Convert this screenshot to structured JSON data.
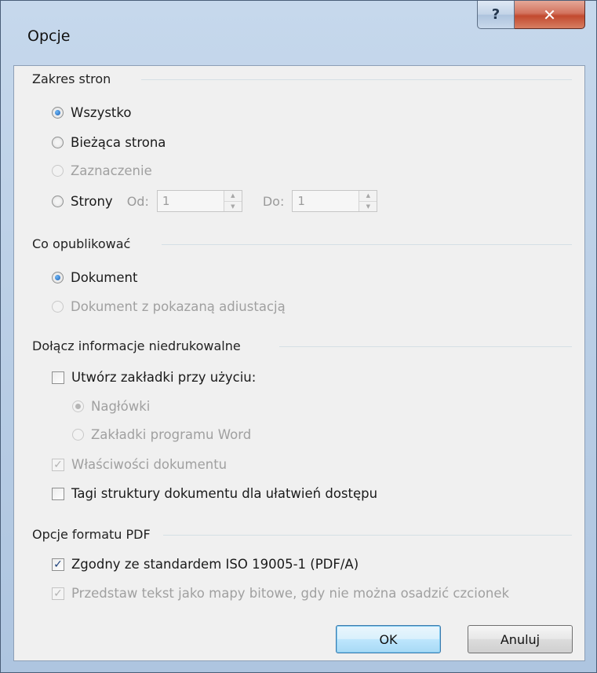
{
  "window": {
    "title": "Opcje",
    "help_glyph": "?",
    "close_glyph": "✕"
  },
  "page_range": {
    "heading": "Zakres stron",
    "all": "Wszystko",
    "current": "Bieżąca strona",
    "selection": "Zaznaczenie",
    "pages": "Strony",
    "from_label": "Od:",
    "from_value": "1",
    "to_label": "Do:",
    "to_value": "1",
    "selected": "all"
  },
  "publish": {
    "heading": "Co opublikować",
    "document": "Dokument",
    "document_markup": "Dokument z pokazaną adiustacją",
    "selected": "document"
  },
  "nonprint": {
    "heading": "Dołącz informacje niedrukowalne",
    "create_bookmarks": "Utwórz zakładki przy użyciu:",
    "create_bookmarks_checked": false,
    "headings": "Nagłówki",
    "word_bookmarks": "Zakładki programu Word",
    "doc_properties": "Właściwości dokumentu",
    "doc_properties_checked": true,
    "structure_tags": "Tagi struktury dokumentu dla ułatwień dostępu",
    "structure_tags_checked": false
  },
  "pdf": {
    "heading": "Opcje formatu PDF",
    "iso": "Zgodny ze standardem ISO 19005-1 (PDF/A)",
    "iso_checked": true,
    "bitmap": "Przedstaw tekst jako mapy bitowe, gdy nie można osadzić czcionek",
    "bitmap_checked": true
  },
  "buttons": {
    "ok": "OK",
    "cancel": "Anuluj"
  },
  "colors": {
    "accent": "#1b5fb5",
    "close_button": "#c24a2f",
    "disabled_text": "#a0a0a0"
  }
}
